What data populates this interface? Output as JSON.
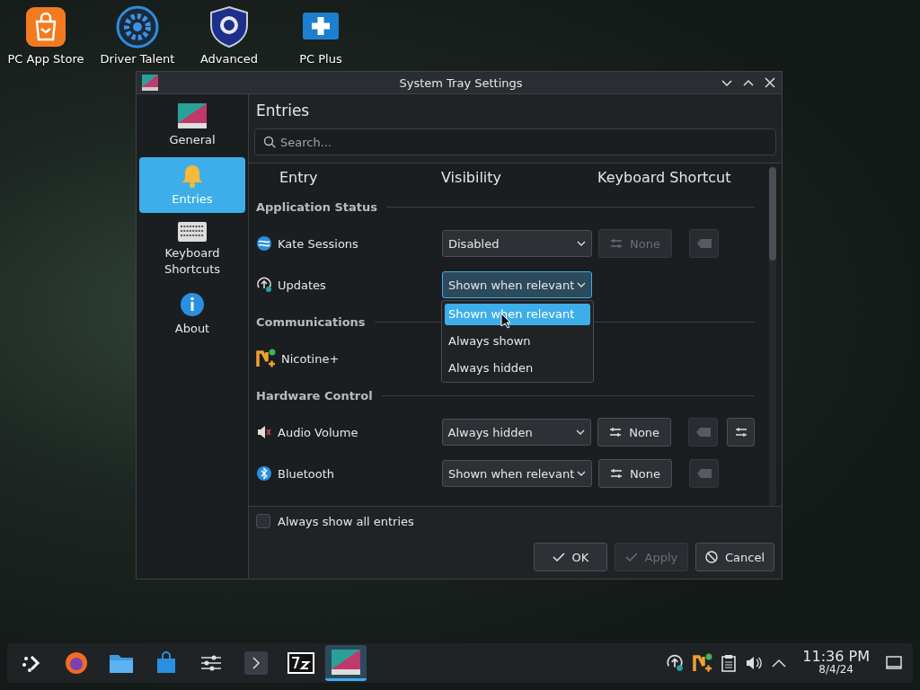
{
  "desktop_icons": [
    {
      "label": "PC App Store",
      "kind": "bag"
    },
    {
      "label": "Driver Talent",
      "kind": "gear"
    },
    {
      "label": "Advanced",
      "kind": "shield"
    },
    {
      "label": "PC Plus",
      "kind": "plus"
    }
  ],
  "window": {
    "title": "System Tray Settings",
    "sidebar": [
      {
        "label": "General",
        "kind": "general",
        "selected": false
      },
      {
        "label": "Entries",
        "kind": "bell",
        "selected": true
      },
      {
        "label": "Keyboard Shortcuts",
        "kind": "keyboard",
        "selected": false
      },
      {
        "label": "About",
        "kind": "info",
        "selected": false
      }
    ],
    "page_title": "Entries",
    "search": {
      "placeholder": "Search..."
    },
    "columns": [
      "Entry",
      "Visibility",
      "Keyboard Shortcut"
    ],
    "groups": [
      {
        "title": "Application Status",
        "entries": [
          {
            "name": "Kate Sessions",
            "visibility": "Disabled",
            "focused": false,
            "shortcut": "None",
            "shortcut_disabled": true,
            "configure": false
          },
          {
            "name": "Updates",
            "visibility": "Shown when relevant",
            "focused": true,
            "options": [
              {
                "label": "Shown when relevant",
                "selected": true
              },
              {
                "label": "Always shown",
                "selected": false
              },
              {
                "label": "Always hidden",
                "selected": false
              }
            ]
          }
        ]
      },
      {
        "title": "Communications",
        "entries": [
          {
            "name": "Nicotine+"
          }
        ]
      },
      {
        "title": "Hardware Control",
        "entries": [
          {
            "name": "Audio Volume",
            "visibility": "Always hidden",
            "focused": false,
            "shortcut": "None",
            "shortcut_disabled": false,
            "configure": true
          },
          {
            "name": "Bluetooth",
            "visibility": "Shown when relevant",
            "focused": false,
            "shortcut": "None",
            "shortcut_disabled": false,
            "configure": false
          }
        ]
      }
    ],
    "show_all": {
      "label": "Always show all entries",
      "checked": false
    },
    "buttons": [
      {
        "label": "OK",
        "kind": "ok",
        "disabled": false
      },
      {
        "label": "Apply",
        "kind": "apply",
        "disabled": true
      },
      {
        "label": "Cancel",
        "kind": "cancel",
        "disabled": false
      }
    ]
  },
  "taskbar": {
    "items": [
      {
        "kind": "launcher",
        "active": false
      },
      {
        "kind": "firefox",
        "active": false
      },
      {
        "kind": "folder",
        "active": false
      },
      {
        "kind": "store",
        "active": false
      },
      {
        "kind": "mixer",
        "active": false
      },
      {
        "kind": "terminal",
        "active": false
      },
      {
        "kind": "sevenzip",
        "active": false
      },
      {
        "kind": "tray",
        "active": true
      }
    ],
    "time": "11:36 PM",
    "date": "8/4/24"
  }
}
